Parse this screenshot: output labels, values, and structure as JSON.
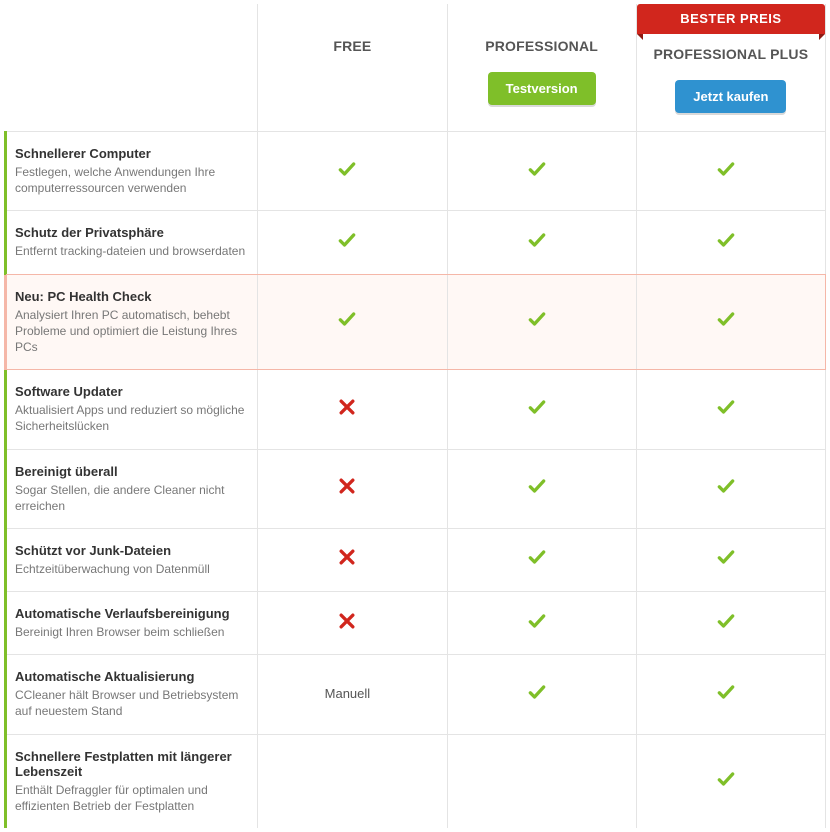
{
  "ribbon": "BESTER PREIS",
  "plans": [
    {
      "name": "FREE"
    },
    {
      "name": "PROFESSIONAL",
      "button": "Testversion",
      "button_style": "green"
    },
    {
      "name": "PROFESSIONAL PLUS",
      "button": "Jetzt kaufen",
      "button_style": "blue",
      "ribbon": true
    }
  ],
  "text_values": {
    "manual": "Manuell"
  },
  "features": [
    {
      "title": "Schnellerer Computer",
      "desc": "Festlegen, welche Anwendungen Ihre computerressourcen verwenden",
      "values": [
        "check",
        "check",
        "check"
      ]
    },
    {
      "title": "Schutz der Privatsphäre",
      "desc": "Entfernt tracking-dateien und browserdaten",
      "values": [
        "check",
        "check",
        "check"
      ]
    },
    {
      "title": "Neu: PC Health Check",
      "desc": "Analysiert Ihren PC automatisch, behebt Probleme und optimiert die Leistung Ihres PCs",
      "values": [
        "check",
        "check",
        "check"
      ],
      "highlight": true
    },
    {
      "title": "Software Updater",
      "desc": "Aktualisiert Apps und reduziert so mögliche Sicherheitslücken",
      "values": [
        "cross",
        "check",
        "check"
      ]
    },
    {
      "title": "Bereinigt überall",
      "desc": "Sogar Stellen, die andere Cleaner nicht erreichen",
      "values": [
        "cross",
        "check",
        "check"
      ]
    },
    {
      "title": "Schützt vor Junk-Dateien",
      "desc": "Echtzeitüberwachung von Datenmüll",
      "values": [
        "cross",
        "check",
        "check"
      ]
    },
    {
      "title": "Automatische Verlaufsbereinigung",
      "desc": "Bereinigt Ihren Browser beim schließen",
      "values": [
        "cross",
        "check",
        "check"
      ]
    },
    {
      "title": "Automatische Aktualisierung",
      "desc": "CCleaner hält Browser und Betriebsystem auf neuestem Stand",
      "values": [
        "text:manual",
        "check",
        "check"
      ]
    },
    {
      "title": "Schnellere Festplatten mit längerer Lebenszeit",
      "desc": "Enthält Defraggler für optimalen und effizienten Betrieb der Festplatten",
      "values": [
        "",
        "",
        "check"
      ]
    }
  ]
}
